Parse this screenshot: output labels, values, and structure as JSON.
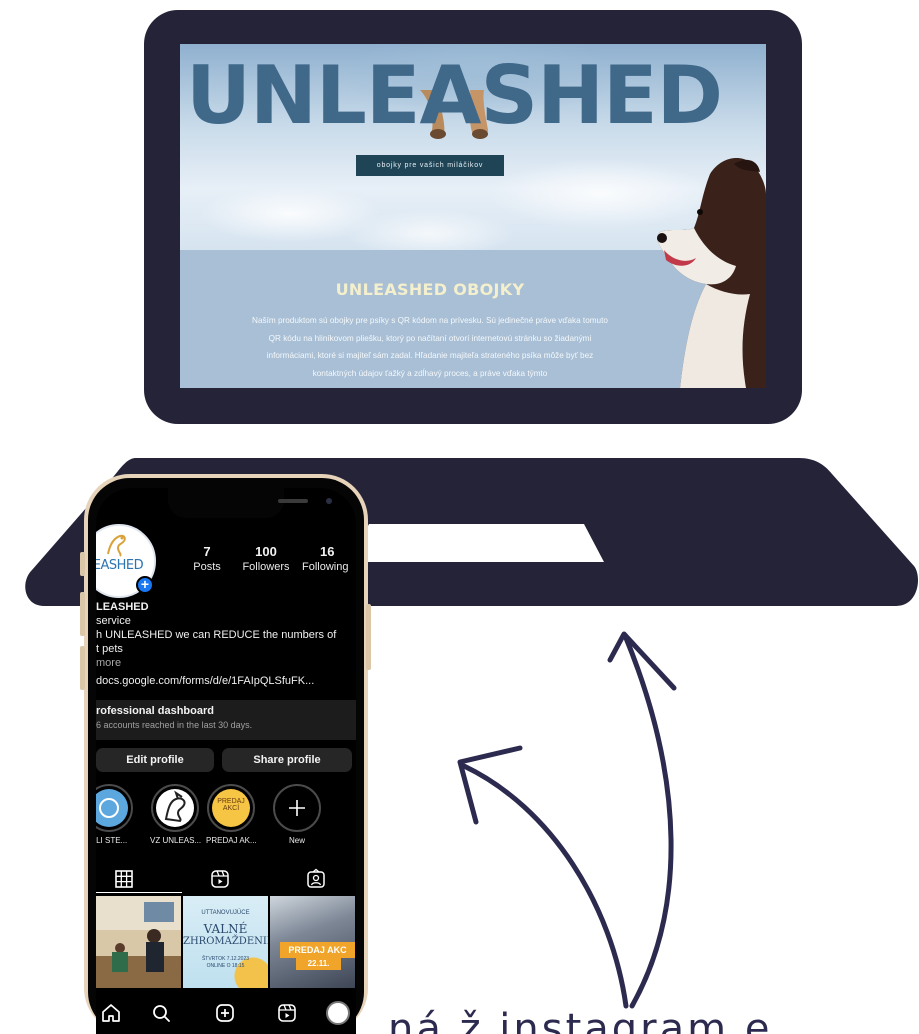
{
  "website": {
    "hero_title": "UNLEASHED",
    "hero_button": "obojky pre vašich miláčikov",
    "section_title": "UNLEASHED OBOJKY",
    "section_text": "Naším produktom sú obojky pre psíky s QR kódom na prívesku. Sú jedinečné práve vďaka tomuto QR kódu na hliníkovom pliešku, ktorý po načítaní otvorí internetovú stránku so žiadanými informáciami, ktoré si majiteľ sám zadal. Hľadanie majiteľa strateného psíka môže byť bez kontaktných údajov ťažký a zdĺhavý proces, a práve vďaka týmto"
  },
  "instagram": {
    "avatar_text": "LEASHED",
    "stats": [
      {
        "value": "7",
        "label": "Posts"
      },
      {
        "value": "100",
        "label": "Followers"
      },
      {
        "value": "16",
        "label": "Following"
      }
    ],
    "name": "LEASHED",
    "category": "service",
    "bio_line1": "h UNLEASHED we can REDUCE the numbers of",
    "bio_line2": "t pets",
    "more": "more",
    "link": "docs.google.com/forms/d/e/1FAIpQLSfuFK...",
    "dashboard_title": "rofessional dashboard",
    "dashboard_sub": "6 accounts reached in the last 30 days.",
    "edit_profile": "Edit profile",
    "share_profile": "Share profile",
    "highlights": [
      {
        "label": "ELI STE..."
      },
      {
        "label": "VZ UNLEAS..."
      },
      {
        "label": "PREDAJ AK...",
        "inner_text_1": "PREDAJ",
        "inner_text_2": "AKCÍ"
      },
      {
        "label": "New"
      }
    ],
    "posts": [
      {
        "alt": "classroom photo"
      },
      {
        "title_small": "UTTANOVUJÚCE",
        "title_1": "VALNÉ",
        "title_2": "ZHROMAŽDENIE",
        "date": "ŠTVRTOK 7.12.2023",
        "time": "ONLINE O 18:15"
      },
      {
        "title": "PREDAJ AKC",
        "date": "22.11."
      }
    ]
  },
  "caption": "ná ž instagram e",
  "colors": {
    "laptop": "#242338",
    "hero_blue": "#3f6889",
    "button_bg": "#1f4456",
    "content_bg": "#a8bfd5",
    "section_title": "#f4efcc",
    "phone_gold": "#e6d3b9",
    "arrow": "#2c2a4e",
    "ig_blue": "#1877f2",
    "highlight_yellow": "#f6c544"
  }
}
